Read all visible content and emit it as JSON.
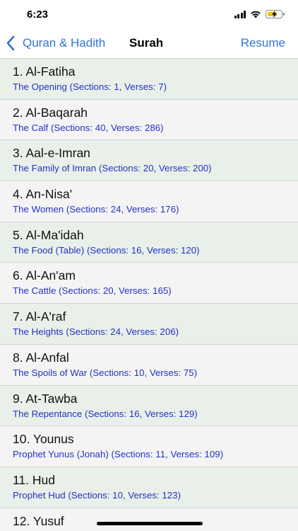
{
  "status_bar": {
    "time": "6:23",
    "icons": [
      "signal-icon",
      "wifi-icon",
      "battery-charging-icon"
    ],
    "battery_color": "#f2c500"
  },
  "nav": {
    "back_label": "Quran & Hadith",
    "title": "Surah",
    "resume_label": "Resume",
    "accent_color": "#2f73d8"
  },
  "surahs": [
    {
      "title": "1. Al-Fatiha",
      "subtitle": "The Opening (Sections: 1, Verses: 7)"
    },
    {
      "title": "2. Al-Baqarah",
      "subtitle": "The Calf (Sections: 40, Verses: 286)"
    },
    {
      "title": "3. Aal-e-Imran",
      "subtitle": "The Family of Imran (Sections: 20, Verses: 200)"
    },
    {
      "title": "4. An-Nisa'",
      "subtitle": "The Women (Sections: 24, Verses: 176)"
    },
    {
      "title": "5. Al-Ma'idah",
      "subtitle": "The Food (Table) (Sections: 16, Verses: 120)"
    },
    {
      "title": "6. Al-An'am",
      "subtitle": "The Cattle (Sections: 20, Verses: 165)"
    },
    {
      "title": "7. Al-A'raf",
      "subtitle": "The Heights (Sections: 24, Verses: 206)"
    },
    {
      "title": "8. Al-Anfal",
      "subtitle": "The Spoils of War (Sections: 10, Verses: 75)"
    },
    {
      "title": "9. At-Tawba",
      "subtitle": "The Repentance (Sections: 16, Verses: 129)"
    },
    {
      "title": "10. Younus",
      "subtitle": "Prophet Yunus (Jonah) (Sections: 11, Verses: 109)"
    },
    {
      "title": "11. Hud",
      "subtitle": "Prophet Hud (Sections: 10, Verses: 123)"
    },
    {
      "title": "12. Yusuf",
      "subtitle": ""
    }
  ],
  "colors": {
    "row_odd": "#e9f0e9",
    "row_even": "#f4f4f4",
    "subtitle": "#2432c2"
  }
}
